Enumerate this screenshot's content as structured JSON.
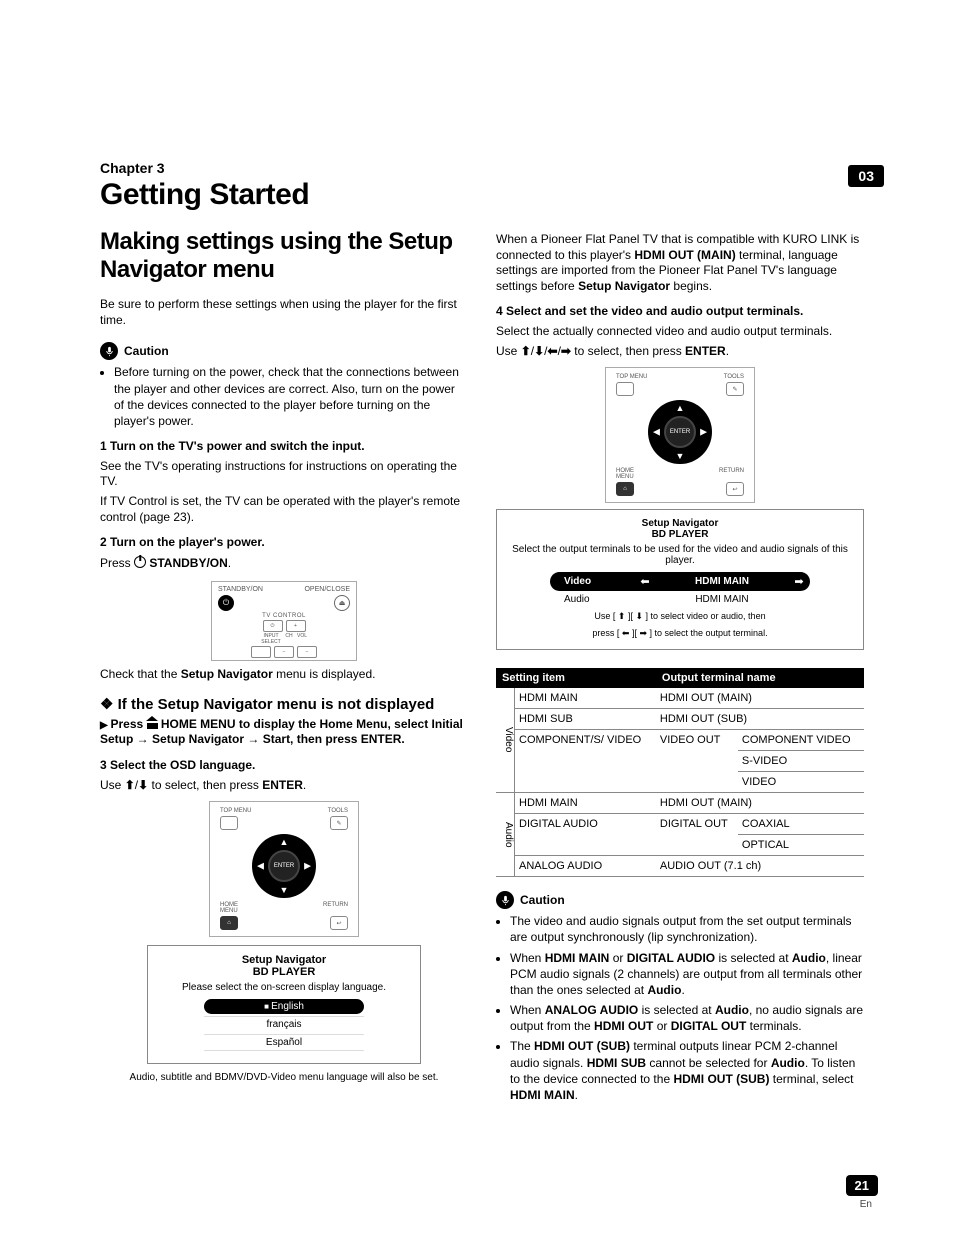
{
  "badge": "03",
  "chapter_label": "Chapter 3",
  "chapter_title": "Getting Started",
  "page_number": "21",
  "page_lang": "En",
  "left": {
    "h2": "Making settings using the Setup Navigator menu",
    "intro": "Be sure to perform these settings when using the player for the first time.",
    "caution_label": "Caution",
    "caution_bullet": "Before turning on the power, check that the connections between the player and other devices are correct. Also, turn on the power of the devices connected to the player before turning on the player's power.",
    "step1_h": "1   Turn on the TV's power and switch the input.",
    "step1_p1": "See the TV's operating instructions for instructions on operating the TV.",
    "step1_p2": "If TV Control is set, the TV can be operated with the player's remote control (page 23).",
    "step2_h": "2   Turn on the player's power.",
    "step2_p_prefix": "Press ",
    "step2_p_btn": " STANDBY/ON",
    "step2_p_suffix": ".",
    "fig_standby": {
      "standby": "STANDBY/ON",
      "openclose": "OPEN/CLOSE",
      "tvc": "TV CONTROL",
      "ch": "CH",
      "vol": "VOL"
    },
    "check_line_a": "Check that the ",
    "check_line_b": "Setup Navigator",
    "check_line_c": " menu is displayed.",
    "subhead": "If the Setup Navigator menu is not displayed",
    "press_home_a": "Press ",
    "press_home_b": " HOME MENU to display the Home Menu, select Initial Setup ",
    "press_home_c": " Setup Navigator ",
    "press_home_d": " Start, then press ENTER.",
    "step3_h": "3   Select the OSD language.",
    "step3_p_a": "Use ",
    "step3_p_b": " to select, then press ",
    "step3_p_c": "ENTER",
    "step3_p_d": ".",
    "remote_labels": {
      "top_menu": "TOP MENU",
      "tools": "TOOLS",
      "home_menu": "HOME\nMENU",
      "return": "RETURN",
      "enter": "ENTER"
    },
    "osd1": {
      "t1": "Setup Navigator",
      "t2": "BD PLAYER",
      "prompt": "Please select the on-screen display language.",
      "langs": [
        "English",
        "français",
        "Español"
      ],
      "note": "Audio, subtitle and BDMV/DVD-Video menu language will also be set."
    }
  },
  "right": {
    "kuro_a": "When a Pioneer Flat Panel TV that is compatible with KURO LINK is connected to this player's ",
    "kuro_b": "HDMI OUT (MAIN)",
    "kuro_c": " terminal, language settings are imported from the Pioneer Flat Panel TV's language settings before ",
    "kuro_d": "Setup Navigator",
    "kuro_e": " begins.",
    "step4_h": "4   Select and set the video and audio output terminals.",
    "step4_p": "Select the actually connected video and audio output terminals.",
    "use_arrows_a": "Use ",
    "use_arrows_b": " to select, then press ",
    "use_arrows_c": "ENTER",
    "use_arrows_d": ".",
    "remote_labels": {
      "top_menu": "TOP MENU",
      "tools": "TOOLS",
      "home_menu": "HOME\nMENU",
      "return": "RETURN",
      "enter": "ENTER"
    },
    "osd2": {
      "t1": "Setup Navigator",
      "t2": "BD PLAYER",
      "prompt": "Select the output terminals to be used for the video and audio signals of this player.",
      "rows": [
        {
          "label": "Video",
          "value": "HDMI MAIN",
          "selected": true
        },
        {
          "label": "Audio",
          "value": "HDMI MAIN",
          "selected": false
        }
      ],
      "inst1": "Use [ ⬆ ][ ⬇ ] to select video or audio, then",
      "inst2": "press [ ⬅ ][ ➡ ] to select the output terminal."
    },
    "table": {
      "th1": "Setting item",
      "th2": "Output terminal name",
      "video_label": "Video",
      "audio_label": "Audio",
      "video_rows": [
        {
          "item": "HDMI MAIN",
          "out": [
            "HDMI OUT (MAIN)"
          ]
        },
        {
          "item": "HDMI SUB",
          "out": [
            "HDMI OUT (SUB)"
          ]
        },
        {
          "item": "COMPONENT/S/ VIDEO",
          "out": [
            "VIDEO OUT",
            "COMPONENT VIDEO",
            "S-VIDEO",
            "VIDEO"
          ]
        }
      ],
      "audio_rows": [
        {
          "item": "HDMI MAIN",
          "out": [
            "HDMI OUT (MAIN)"
          ]
        },
        {
          "item": "DIGITAL AUDIO",
          "out": [
            "DIGITAL OUT",
            "COAXIAL",
            "OPTICAL"
          ]
        },
        {
          "item": "ANALOG AUDIO",
          "out": [
            "AUDIO OUT (7.1 ch)"
          ]
        }
      ]
    },
    "caution_label": "Caution",
    "cautions": {
      "c1": "The video and audio signals output from the set output terminals are output synchronously (lip synchronization).",
      "c2_a": "When ",
      "c2_b": "HDMI MAIN",
      "c2_c": " or ",
      "c2_d": "DIGITAL AUDIO",
      "c2_e": " is selected at ",
      "c2_f": "Audio",
      "c2_g": ", linear PCM audio signals (2 channels) are output from all terminals other than the ones selected at ",
      "c2_h": "Audio",
      "c2_i": ".",
      "c3_a": "When ",
      "c3_b": "ANALOG AUDIO",
      "c3_c": " is selected at ",
      "c3_d": "Audio",
      "c3_e": ", no audio signals are output from the ",
      "c3_f": "HDMI OUT",
      "c3_g": " or ",
      "c3_h": "DIGITAL OUT",
      "c3_i": " terminals.",
      "c4_a": "The ",
      "c4_b": "HDMI OUT (SUB)",
      "c4_c": " terminal outputs linear PCM 2-channel audio signals. ",
      "c4_d": "HDMI SUB",
      "c4_e": " cannot be selected for ",
      "c4_f": "Audio",
      "c4_g": ". To listen to the device connected to the ",
      "c4_h": "HDMI OUT (SUB)",
      "c4_i": " terminal, select ",
      "c4_j": "HDMI MAIN",
      "c4_k": "."
    }
  }
}
